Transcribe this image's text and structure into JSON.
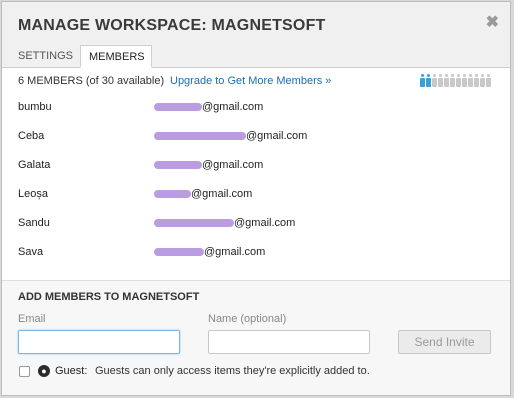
{
  "dialog": {
    "title": "MANAGE WORKSPACE: MAGNETSOFT",
    "close_glyph": "✖"
  },
  "tabs": [
    {
      "label": "SETTINGS",
      "active": false
    },
    {
      "label": "MEMBERS",
      "active": true
    }
  ],
  "members_section": {
    "count_text": "6 MEMBERS (of 30 available)",
    "upgrade_link": "Upgrade to Get More Members »",
    "seat_icons": {
      "used": 2,
      "total": 12,
      "used_color": "#3b9fd8",
      "free_color": "#c9c9c9"
    },
    "members": [
      {
        "name": "bumbu",
        "email_suffix": "@gmail.com"
      },
      {
        "name": "Ceba",
        "email_suffix": "@gmail.com"
      },
      {
        "name": "Galata",
        "email_suffix": "@gmail.com"
      },
      {
        "name": "Leoșa",
        "email_suffix": "@gmail.com"
      },
      {
        "name": "Sandu",
        "email_suffix": "@gmail.com"
      },
      {
        "name": "Sava",
        "email_suffix": "@gmail.com"
      }
    ]
  },
  "add_members": {
    "title": "ADD MEMBERS TO MAGNETSOFT",
    "email_label": "Email",
    "email_value": "",
    "name_label": "Name (optional)",
    "name_value": "",
    "send_button": "Send Invite",
    "guest_label": "Guest:",
    "guest_description": "Guests can only access items they're explicitly added to.",
    "globe_glyph": "●"
  },
  "colors": {
    "link": "#1a6fb5",
    "redaction": "#b99de0"
  }
}
